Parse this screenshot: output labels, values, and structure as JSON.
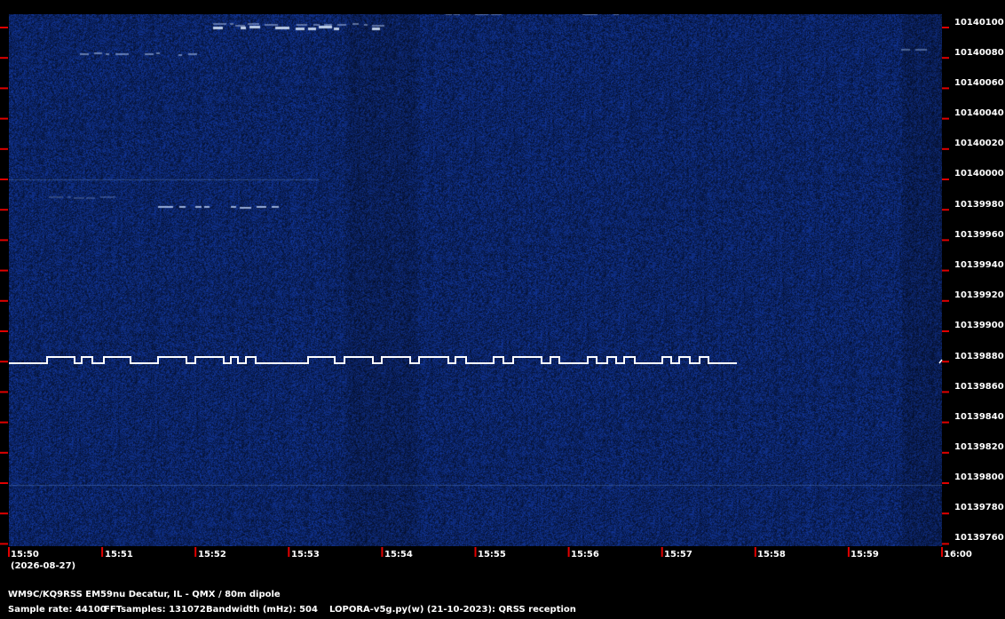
{
  "spectrogram": {
    "freq_labels": [
      "10140100",
      "10140080",
      "10140060",
      "10140040",
      "10140020",
      "10140000",
      "10139980",
      "10139960",
      "10139940",
      "10139920",
      "10139900",
      "10139880",
      "10139860",
      "10139840",
      "10139820",
      "10139800",
      "10139780",
      "10139760"
    ],
    "time_labels": [
      "15:50",
      "15:51",
      "15:52",
      "15:53",
      "15:54",
      "15:55",
      "15:56",
      "15:57",
      "15:58",
      "15:59",
      "16:00"
    ],
    "date_label": "(2026-08-27)",
    "background_color": "#0a1f55",
    "signal_color": "#ffffff",
    "tick_color": "#e00000"
  },
  "footer": {
    "station": "WM9C/KQ9RSS EM59nu Decatur, IL - QMX / 80m dipole",
    "sample_rate": "Sample rate: 44100",
    "fft_samples": "FFTsamples: 131072",
    "bandwidth": "Bandwidth (mHz): 504",
    "software": "LOPORA-v5g.py(w) (21-10-2023): QRSS reception"
  }
}
